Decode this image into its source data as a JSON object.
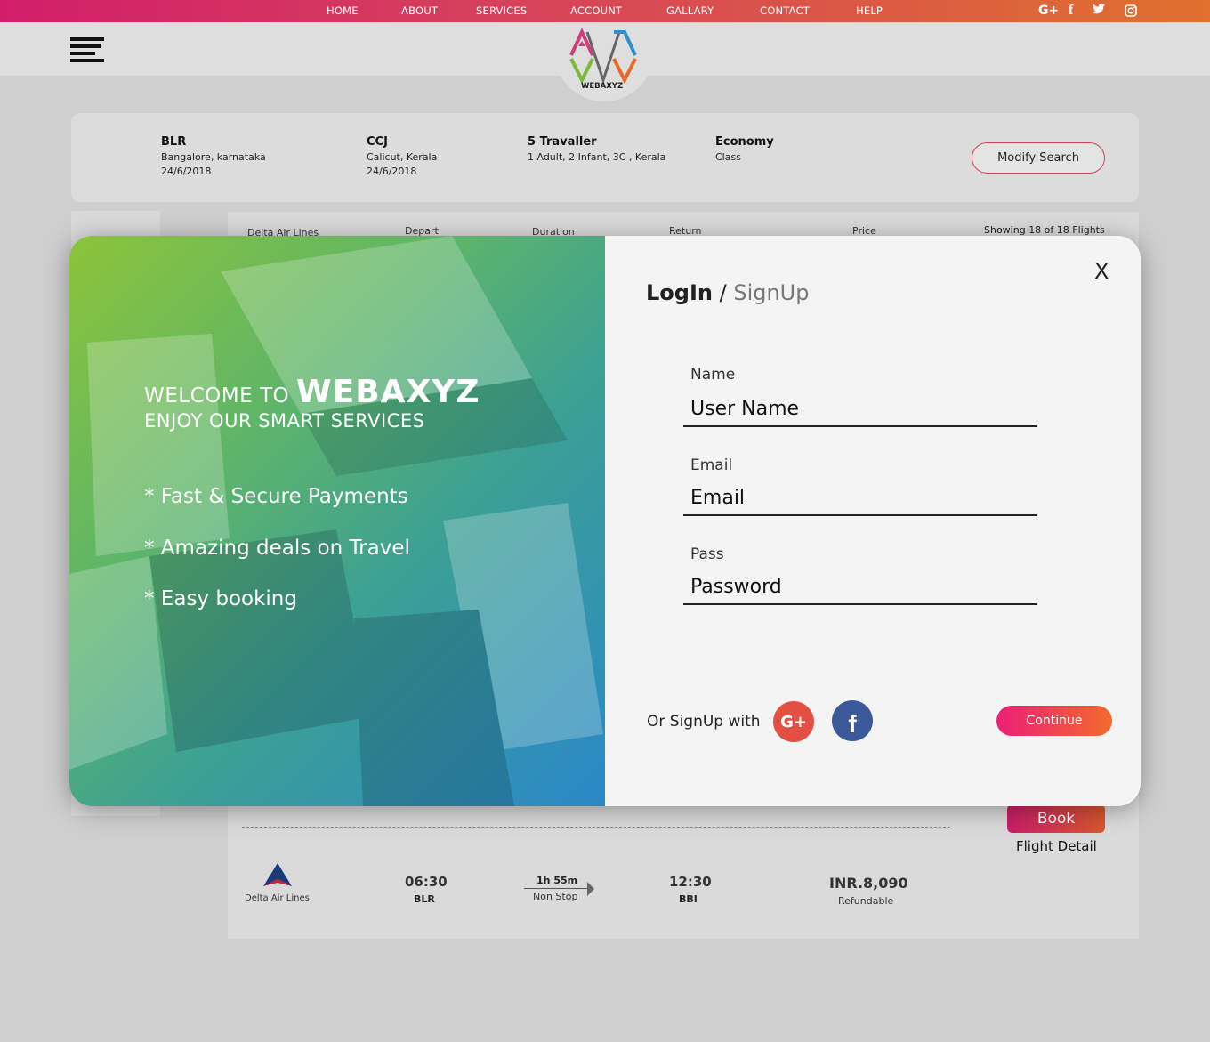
{
  "topnav": {
    "items": [
      "HOME",
      "ABOUT",
      "SERVICES",
      "ACCOUNT",
      "GALLARY",
      "CONTACT",
      "HELP"
    ],
    "social": [
      {
        "icon": "google-plus-icon",
        "glyph": "G+"
      },
      {
        "icon": "facebook-icon",
        "glyph": "f"
      },
      {
        "icon": "twitter-icon",
        "glyph": "t"
      },
      {
        "icon": "instagram-icon",
        "glyph": ""
      }
    ]
  },
  "header": {
    "logo_text": "WEBAXYZ"
  },
  "search": {
    "from": {
      "code": "BLR",
      "city": "Bangalore, karnataka",
      "date": "24/6/2018"
    },
    "to": {
      "code": "CCJ",
      "city": "Calicut, Kerala",
      "date": "24/6/2018"
    },
    "travellers": {
      "title": "5 Travaller",
      "detail": "1 Adult, 2 Infant, 3C , Kerala"
    },
    "class": {
      "title": "Economy",
      "detail": "Class"
    },
    "modify_label": "Modify Search"
  },
  "results": {
    "columns": [
      "Delta Air Lines",
      "Depart",
      "Duration",
      "Return",
      "Price"
    ],
    "showing": "Showing 18 of 18 Flights",
    "book_label": "Book",
    "flight_detail_label": "Flight Detail",
    "flight": {
      "airline": "Delta Air Lines",
      "depart_time": "06:30",
      "depart_code": "BLR",
      "duration": "1h 55m",
      "stops": "Non Stop",
      "arrive_time": "12:30",
      "arrive_code": "BBI",
      "price": "INR.8,090",
      "refund": "Refundable"
    }
  },
  "modal": {
    "welcome_prefix": "WELCOME TO",
    "brand": "WEBAXYZ",
    "tagline": "ENJOY OUR SMART SERVICES",
    "features": [
      "* Fast & Secure Payments",
      "* Amazing deals on Travel",
      "* Easy booking"
    ],
    "close": "X",
    "tab_login": "LogIn",
    "tab_sep": " / ",
    "tab_signup": "SignUp",
    "fields": [
      {
        "label": "Name",
        "placeholder": "User Name"
      },
      {
        "label": "Email",
        "placeholder": "Email"
      },
      {
        "label": "Pass",
        "placeholder": "Password"
      }
    ],
    "or_signup": "Or SignUp with",
    "continue_label": "Continue",
    "colors": {
      "gradient_start": "#8cc43a",
      "gradient_end": "#2a88c8",
      "accent": "#ec1f78"
    }
  }
}
